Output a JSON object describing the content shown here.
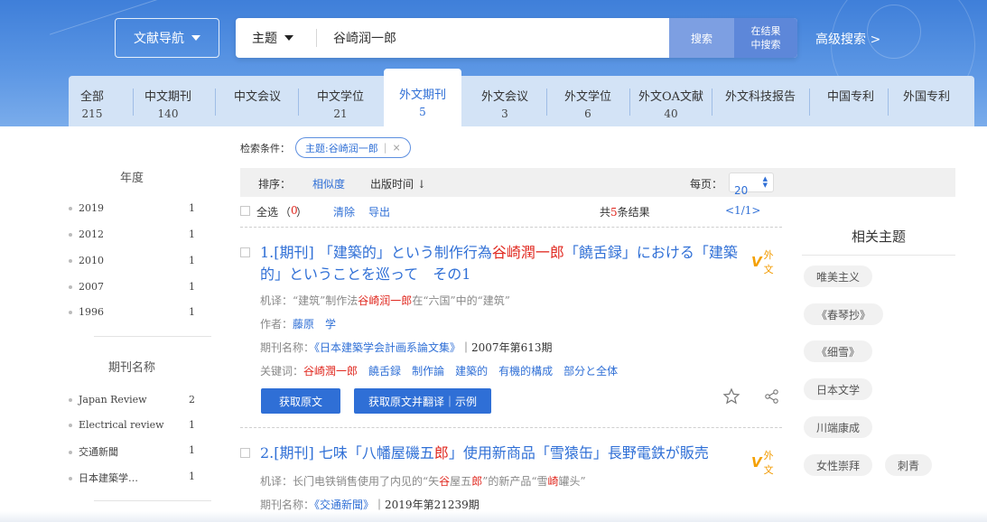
{
  "header": {
    "nav_button": "文献导航",
    "search_field": "主题",
    "search_value": "谷崎润一郎",
    "search_button": "搜索",
    "search_within_line1": "在结果",
    "search_within_line2": "中搜索",
    "advanced_search": "高级搜索 >"
  },
  "tabs": [
    {
      "label": "全部",
      "count": "215"
    },
    {
      "label": "中文期刊",
      "count": "140"
    },
    {
      "label": "中文会议",
      "count": ""
    },
    {
      "label": "中文学位",
      "count": "21"
    },
    {
      "label": "外文期刊",
      "count": "5"
    },
    {
      "label": "外文会议",
      "count": "3"
    },
    {
      "label": "外文学位",
      "count": "6"
    },
    {
      "label": "外文OA文献",
      "count": "40"
    },
    {
      "label": "外文科技报告",
      "count": ""
    },
    {
      "label": "中国专利",
      "count": ""
    },
    {
      "label": "外国专利",
      "count": ""
    }
  ],
  "sidebar": {
    "year_title": "年度",
    "years": [
      {
        "label": "2019",
        "count": "1"
      },
      {
        "label": "2012",
        "count": "1"
      },
      {
        "label": "2010",
        "count": "1"
      },
      {
        "label": "2007",
        "count": "1"
      },
      {
        "label": "1996",
        "count": "1"
      }
    ],
    "journal_title": "期刊名称",
    "journals": [
      {
        "label": "Japan Review",
        "count": "2"
      },
      {
        "label": "Electrical review",
        "count": "1"
      },
      {
        "label": "交通新聞",
        "count": "1"
      },
      {
        "label": "日本建築学…",
        "count": "1"
      }
    ]
  },
  "conditions": {
    "label": "检索条件：",
    "chip_text": "主题:谷崎润一郎",
    "chip_sep": "|",
    "chip_close": "×"
  },
  "sort": {
    "label": "排序：",
    "relevance": "相似度",
    "pubtime": "出版时间 ↓",
    "per_page_label": "每页：",
    "per_page_value": "20"
  },
  "selection": {
    "select_all": "全选",
    "selected_open": "（",
    "selected_count": "0",
    "selected_close": "）",
    "clear": "清除",
    "export": "导出",
    "total_prefix": "共",
    "total_count": "5",
    "total_suffix": "条结果",
    "pager": "<1/1>"
  },
  "results": [
    {
      "title_part1": "1.[期刊] 「建築的」という制作行為",
      "title_hl1": "谷崎潤一郎",
      "title_part2": "「饒舌録」における「建築",
      "title_line2": "的」ということを巡って　その1",
      "badge": "外文",
      "translation_label": "机译：",
      "translation_p1": "“建筑”制作法",
      "translation_hl": "谷崎润一郎",
      "translation_p2": "在“六国”中的“建筑”",
      "author_label": "作者：",
      "author": "藤原　学",
      "journal_label": "期刊名称：",
      "journal": "《日本建築学会計画系論文集》",
      "issue": "｜2007年第613期",
      "keywords_label": "关键词：",
      "keywords": [
        "谷崎潤一郎",
        "饒舌録",
        "制作論",
        "建築的",
        "有機的構成",
        "部分と全体"
      ],
      "btn_get": "获取原文",
      "btn_translate": "获取原文并翻译｜示例"
    },
    {
      "title_part1": "2.[期刊] 七味「八幡屋磯五",
      "title_hl1": "郎",
      "title_part2": "」使用新商品「雪猿缶」長野電鉄が販売",
      "badge": "外文",
      "translation_label": "机译：",
      "translation_p1": "长门电铁销售使用了内见的“矢",
      "translation_hl": "谷",
      "translation_p2": "屋五",
      "translation_hl2": "郎",
      "translation_p3": "”的新产品“雪",
      "translation_hl3": "崎",
      "translation_p4": "罐头”",
      "journal_label": "期刊名称：",
      "journal": "《交通新聞》",
      "issue": "｜2019年第21239期"
    }
  ],
  "related": {
    "title": "相关主题",
    "tags": [
      "唯美主义",
      "《春琴抄》",
      "《细雪》",
      "日本文学",
      "川端康成",
      "女性崇拜",
      "刺青"
    ]
  },
  "colors": {
    "primary_blue": "#2f6fd6",
    "highlight_red": "#e0281f",
    "tab_bg": "#d3e3f6",
    "badge_orange": "#f4a000"
  }
}
